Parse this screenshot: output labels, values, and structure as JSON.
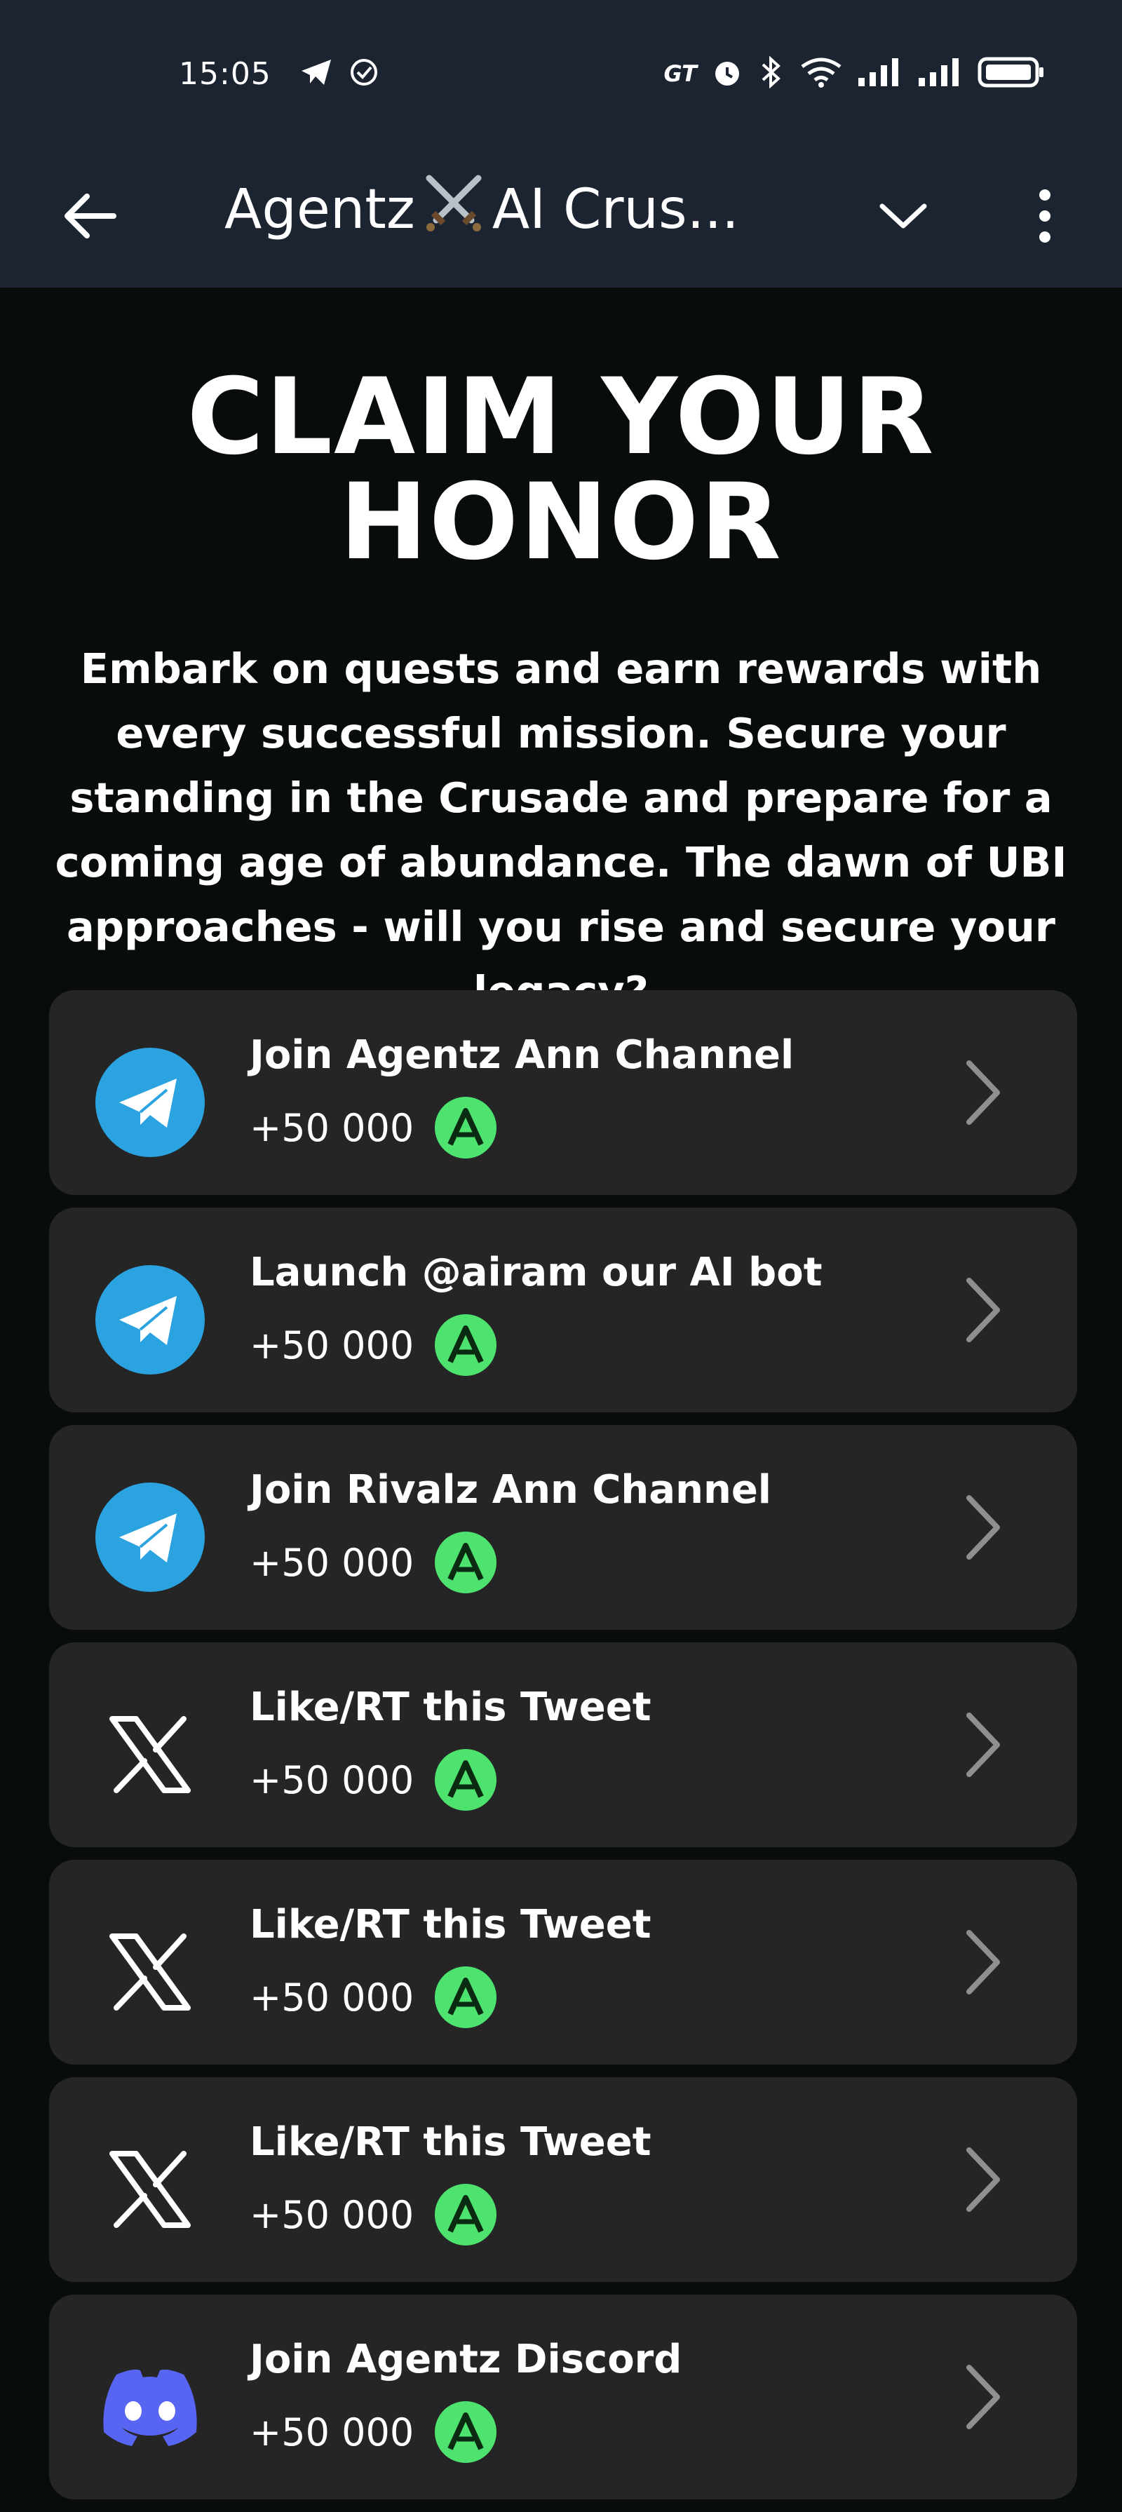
{
  "status_bar": {
    "time": "15:05",
    "carrier_badge": "GT",
    "icons": [
      "telegram-send-icon",
      "check-circle-icon",
      "alarm-icon",
      "bluetooth-icon",
      "wifi-icon",
      "signal-icon",
      "signal-icon",
      "battery-icon"
    ]
  },
  "app_bar": {
    "title_part1": "Agentz",
    "title_part2": "AI Crus...",
    "icons": [
      "back-arrow-icon",
      "crossed-swords-icon",
      "chevron-down-icon",
      "more-vert-icon"
    ]
  },
  "hero": {
    "title": "CLAIM YOUR HONOR",
    "description": "Embark on quests and earn rewards with every successful mission. Secure your standing in the Crusade and prepare for a coming age of abundance. The dawn of UBI approaches - will you rise and secure your legacy?"
  },
  "tasks": [
    {
      "icon": "telegram-icon",
      "title": "Join Agentz Ann Channel",
      "reward": "+50 000"
    },
    {
      "icon": "telegram-icon",
      "title": "Launch @airam our AI bot",
      "reward": "+50 000"
    },
    {
      "icon": "telegram-icon",
      "title": "Join Rivalz Ann Channel",
      "reward": "+50 000"
    },
    {
      "icon": "x-icon",
      "title": "Like/RT this Tweet",
      "reward": "+50 000"
    },
    {
      "icon": "x-icon",
      "title": "Like/RT this Tweet",
      "reward": "+50 000"
    },
    {
      "icon": "x-icon",
      "title": "Like/RT this Tweet",
      "reward": "+50 000"
    },
    {
      "icon": "discord-icon",
      "title": "Join Agentz Discord",
      "reward": "+50 000"
    }
  ],
  "token_badge_letter": "A",
  "colors": {
    "background": "#080d0a",
    "header": "#1c2432",
    "card": "#252525",
    "token_green": "#4ee36f",
    "telegram_blue": "#2aa3e0",
    "discord_purple": "#5865f2"
  }
}
